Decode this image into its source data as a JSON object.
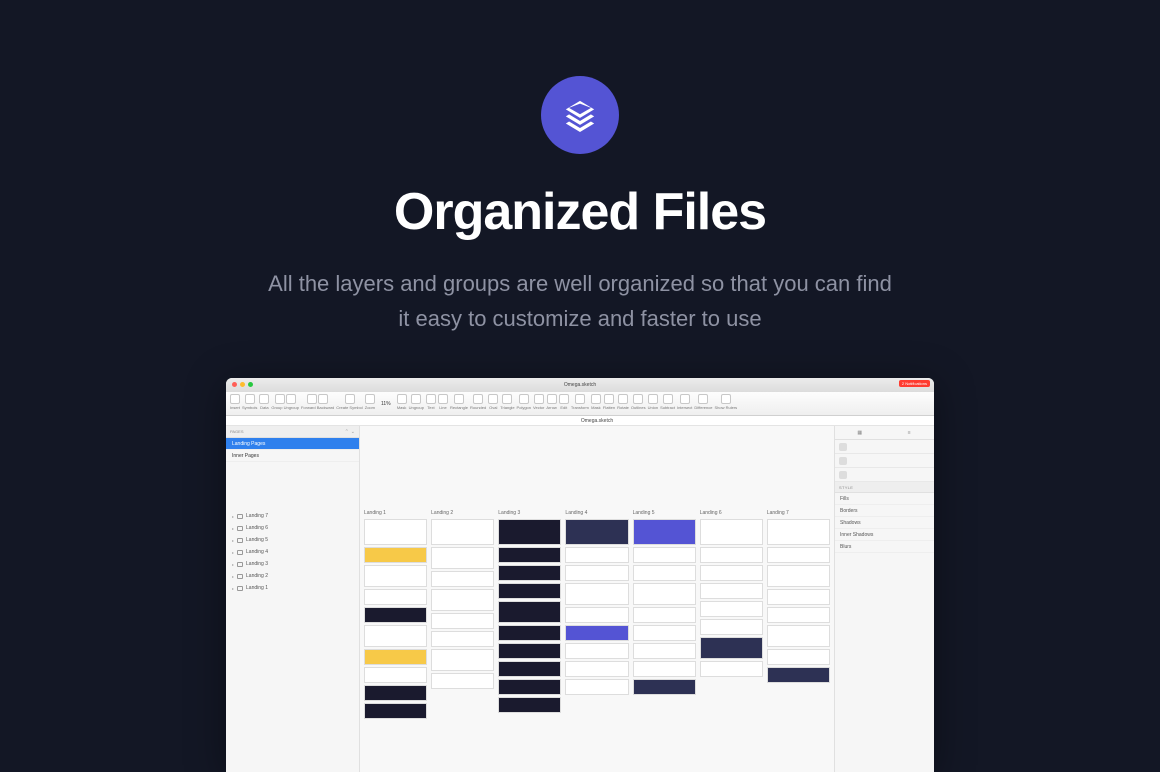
{
  "hero": {
    "title": "Organized Files",
    "subtitle": "All the layers and groups are well organized so that you can find it easy to customize and faster to use"
  },
  "window": {
    "title": "Omega.sketch",
    "notification": "2 Notifications",
    "canvas_title": "Omega.sketch"
  },
  "toolbar": {
    "groups": [
      {
        "btns": 1,
        "label": "Insert"
      },
      {
        "btns": 1,
        "label": "Symbols"
      },
      {
        "btns": 1,
        "label": "Data"
      },
      {
        "btns": 2,
        "label": "Group Ungroup"
      },
      {
        "btns": 2,
        "label": "Forward Backward"
      },
      {
        "btns": 1,
        "label": "Create Symbol"
      },
      {
        "btns": 1,
        "label": "Zoom"
      }
    ],
    "zoom": "11%",
    "groups_mid": [
      {
        "btns": 1,
        "label": "Mask"
      },
      {
        "btns": 1,
        "label": "Ungroup"
      },
      {
        "btns": 1,
        "label": "Text"
      },
      {
        "btns": 1,
        "label": "Line"
      },
      {
        "btns": 1,
        "label": "Rectangle"
      },
      {
        "btns": 1,
        "label": "Rounded"
      },
      {
        "btns": 1,
        "label": "Oval"
      },
      {
        "btns": 1,
        "label": "Triangle"
      },
      {
        "btns": 1,
        "label": "Polygon"
      },
      {
        "btns": 1,
        "label": "Vector"
      },
      {
        "btns": 1,
        "label": "Arrow"
      }
    ],
    "groups_right": [
      {
        "btns": 1,
        "label": "Edit"
      },
      {
        "btns": 1,
        "label": "Transform"
      },
      {
        "btns": 1,
        "label": "Mask"
      },
      {
        "btns": 1,
        "label": "Flatten"
      },
      {
        "btns": 1,
        "label": "Rotate"
      },
      {
        "btns": 1,
        "label": "Outlines"
      },
      {
        "btns": 1,
        "label": "Union"
      },
      {
        "btns": 1,
        "label": "Subtract"
      },
      {
        "btns": 1,
        "label": "Intersect"
      },
      {
        "btns": 1,
        "label": "Difference"
      },
      {
        "btns": 1,
        "label": "Show Rulers"
      }
    ]
  },
  "sidebar": {
    "header": "PAGES",
    "pages": [
      {
        "label": "Landing Pages",
        "active": true
      },
      {
        "label": "Inner Pages",
        "active": false
      }
    ],
    "layers": [
      {
        "label": "Landing 7"
      },
      {
        "label": "Landing 6"
      },
      {
        "label": "Landing 5"
      },
      {
        "label": "Landing 4"
      },
      {
        "label": "Landing 3"
      },
      {
        "label": "Landing 2"
      },
      {
        "label": "Landing 1"
      }
    ]
  },
  "canvas": {
    "artboards": [
      {
        "label": "Landing 1"
      },
      {
        "label": "Landing 2"
      },
      {
        "label": "Landing 3"
      },
      {
        "label": "Landing 4"
      },
      {
        "label": "Landing 5"
      },
      {
        "label": "Landing 6"
      },
      {
        "label": "Landing 7"
      }
    ]
  },
  "inspector": {
    "style_header": "STYLE",
    "props": [
      {
        "label": "Fills"
      },
      {
        "label": "Borders"
      },
      {
        "label": "Shadows"
      },
      {
        "label": "Inner Shadows"
      },
      {
        "label": "Blurs"
      }
    ]
  }
}
